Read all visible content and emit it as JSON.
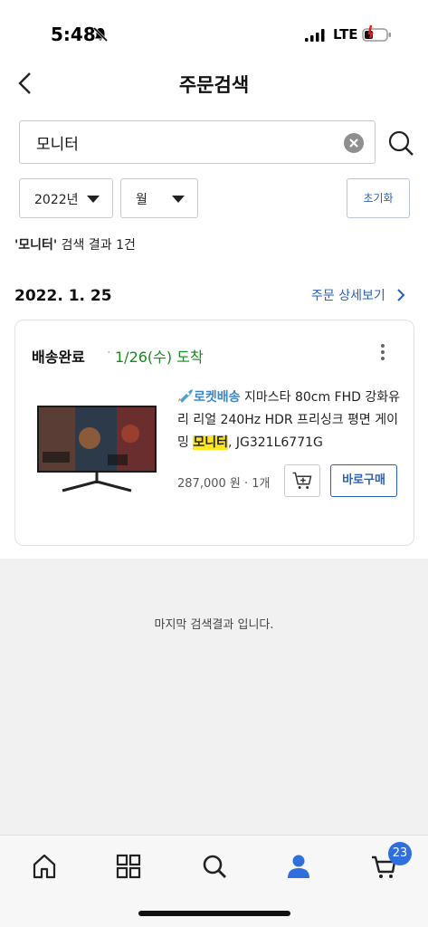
{
  "status_bar": {
    "time": "5:48",
    "network": "LTE"
  },
  "header": {
    "title": "주문검색"
  },
  "search": {
    "value": "모니터"
  },
  "filters": {
    "year": "2022년",
    "month": "월",
    "reset_label": "초기화"
  },
  "result": {
    "keyword": "'모니터'",
    "summary": " 검색 결과 1건"
  },
  "order": {
    "date": "2022. 1. 25",
    "detail_link": "주문 상세보기",
    "delivery_status": "배송완료",
    "delivery_date": "1/26(수) 도착",
    "product": {
      "rocket_label": "로켓배송",
      "name_before": " 지마스타 80cm FHD 강화유리 리얼 240Hz HDR 프리싱크 평면 게이밍 ",
      "highlight": "모니터",
      "name_after": ", JG321L6771G",
      "price_text": "287,000 원 · 1개"
    },
    "buy_label": "바로구매"
  },
  "end_message": "마지막 검색결과 입니다.",
  "bottom_nav": {
    "cart_count": "23"
  },
  "colors": {
    "accent_blue": "#2a5fb8",
    "delivery_green": "#138a1b",
    "highlight_yellow": "#ffe623",
    "badge_blue": "#2f6fdd"
  },
  "icons": [
    "bell-off-icon",
    "signal-icon",
    "battery-icon",
    "back-arrow-icon",
    "clear-icon",
    "search-icon",
    "dropdown-arrow-icon",
    "chevron-right-icon",
    "more-vertical-icon",
    "rocket-icon",
    "add-to-cart-icon",
    "home-icon",
    "category-grid-icon",
    "person-icon",
    "cart-icon"
  ]
}
